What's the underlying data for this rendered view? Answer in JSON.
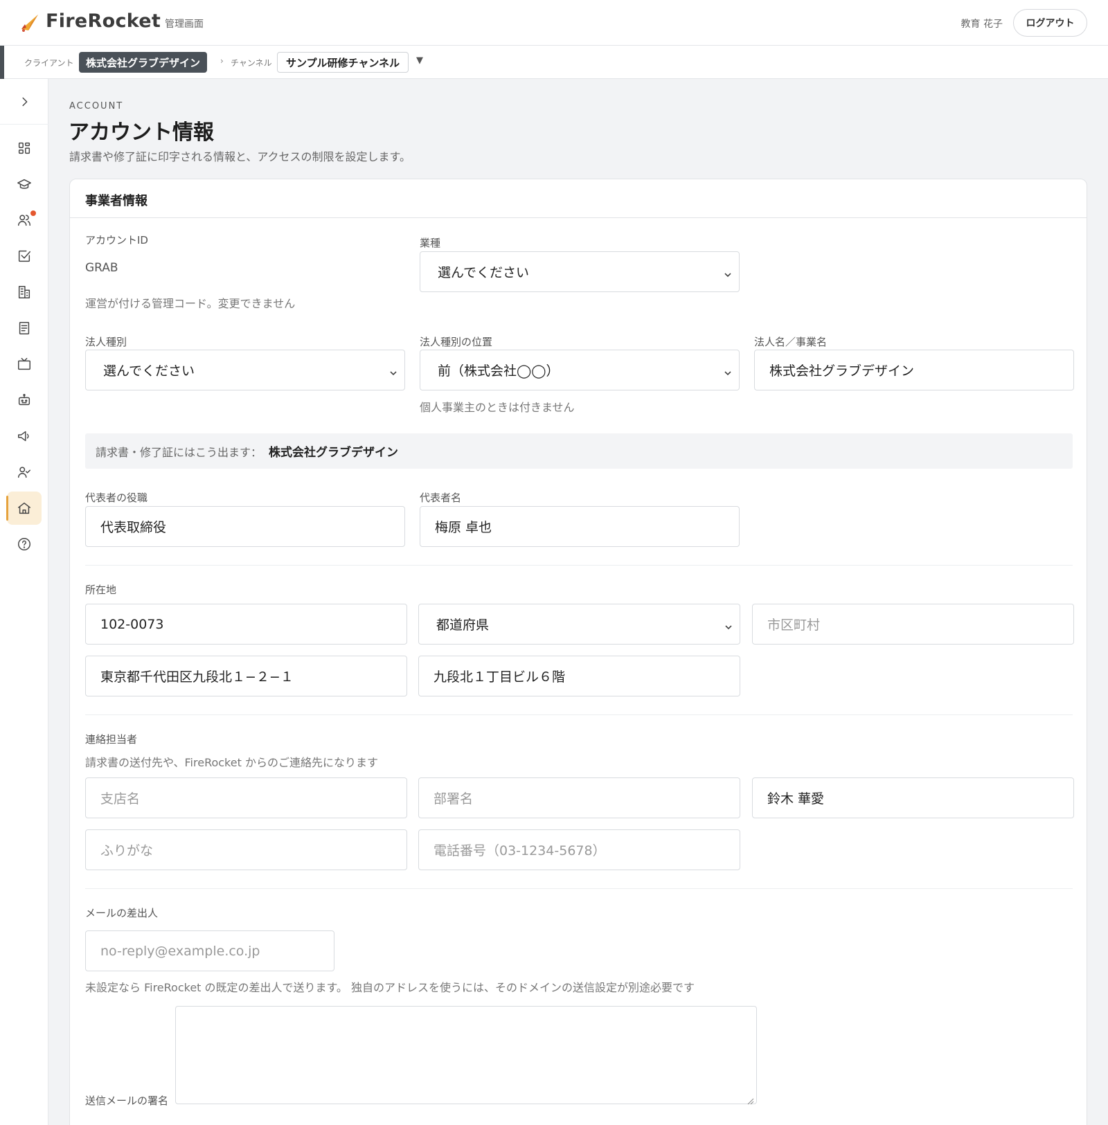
{
  "app": {
    "name": "FireRocket",
    "area": "管理画面"
  },
  "user": {
    "name": "教育 花子",
    "logout_label": "ログアウト"
  },
  "context": {
    "client_label": "クライアント",
    "client_name": "株式会社グラブデザイン",
    "separator": "›",
    "channel_label": "チャンネル",
    "channel_name": "サンプル研修チャンネル",
    "channel_caret": "▼"
  },
  "sidebar": {
    "toggle_icon": "chevron-right-icon",
    "items": [
      {
        "icon": "dashboard-icon",
        "active": false
      },
      {
        "icon": "graduation-cap-icon",
        "active": false
      },
      {
        "icon": "users-icon",
        "active": false,
        "notification": true
      },
      {
        "icon": "checkbox-icon",
        "active": false
      },
      {
        "icon": "building-icon",
        "active": false
      },
      {
        "icon": "document-icon",
        "active": false
      },
      {
        "icon": "tv-icon",
        "active": false
      },
      {
        "icon": "robot-icon",
        "active": false
      },
      {
        "icon": "megaphone-icon",
        "active": false
      },
      {
        "icon": "user-check-icon",
        "active": false
      },
      {
        "icon": "home-icon",
        "active": true
      },
      {
        "icon": "help-icon",
        "active": false
      }
    ]
  },
  "page": {
    "eyebrow": "ACCOUNT",
    "title": "アカウント情報",
    "description": "請求書や修了証に印字される情報と、アクセスの制限を設定します。"
  },
  "business": {
    "section_title": "事業者情報",
    "account_id": {
      "label": "アカウントID",
      "value": "GRAB",
      "help": "運営が付ける管理コード。変更できません"
    },
    "industry": {
      "label": "業種",
      "value": "選んでください"
    },
    "corp_type": {
      "label": "法人種別",
      "value": "選んでください"
    },
    "corp_type_position": {
      "label": "法人種別の位置",
      "value": "前（株式会社◯◯）",
      "help": "個人事業主のときは付きません"
    },
    "corp_name": {
      "label": "法人名／事業名",
      "value": "株式会社グラブデザイン"
    },
    "preview": {
      "label": "請求書・修了証にはこう出ます：",
      "value": "株式会社グラブデザイン"
    },
    "rep_title": {
      "label": "代表者の役職",
      "value": "代表取締役"
    },
    "rep_name": {
      "label": "代表者名",
      "value": "梅原 卓也"
    },
    "address": {
      "label": "所在地",
      "postal": "102-0073",
      "prefecture": "都道府県",
      "city_placeholder": "市区町村",
      "street": "東京都千代田区九段北１−２−１",
      "building": "九段北１丁目ビル６階"
    },
    "contact": {
      "label": "連絡担当者",
      "help": "請求書の送付先や、FireRocket からのご連絡先になります",
      "branch_placeholder": "支店名",
      "department_placeholder": "部署名",
      "name": "鈴木 華愛",
      "kana_placeholder": "ふりがな",
      "phone_placeholder": "電話番号（03-1234-5678）"
    },
    "mail": {
      "label": "メールの差出人",
      "from_placeholder": "no-reply@example.co.jp",
      "help": "未設定なら FireRocket の既定の差出人で送ります。 独自のアドレスを使うには、そのドメインの送信設定が別途必要です",
      "signature_label": "送信メールの署名"
    }
  }
}
